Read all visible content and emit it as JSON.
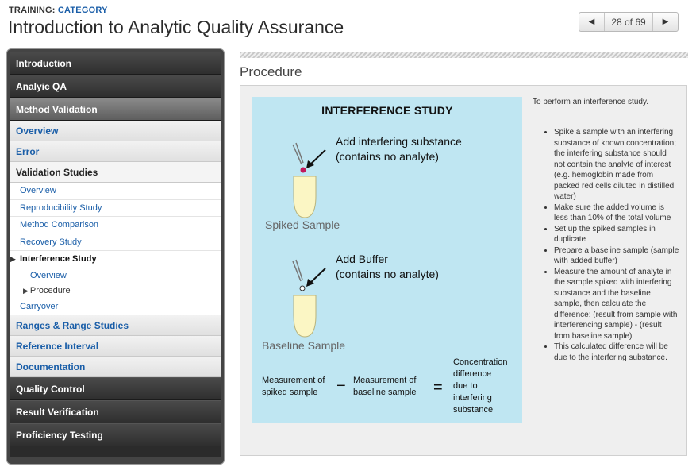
{
  "header": {
    "breadcrumb_prefix": "TRAINING:",
    "breadcrumb_link": "CATEGORY",
    "title": "Introduction to Analytic Quality Assurance"
  },
  "pager": {
    "prev_icon": "left-triangle",
    "next_icon": "right-triangle",
    "count": "28 of 69"
  },
  "sidebar": {
    "top_items": [
      "Introduction",
      "Analyic QA"
    ],
    "active_item": "Method Validation",
    "sections": {
      "overview": "Overview",
      "error": "Error",
      "validation_studies": "Validation Studies"
    },
    "sub_items": {
      "overview": "Overview",
      "reproducibility": "Reproducibility Study",
      "method_comparison": "Method Comparison",
      "recovery": "Recovery Study",
      "interference": "Interference Study",
      "interference_overview": "Overview",
      "procedure": "Procedure",
      "carryover": "Carryover"
    },
    "more_sections": {
      "ranges": "Ranges & Range Studies",
      "reference": "Reference Interval",
      "documentation": "Documentation"
    },
    "bottom_items": [
      "Quality Control",
      "Result Verification",
      "Proficiency Testing"
    ]
  },
  "main": {
    "section_title": "Procedure",
    "figure": {
      "title": "INTERFERENCE STUDY",
      "step1_line1": "Add interfering substance",
      "step1_line2": "(contains no analyte)",
      "spiked_caption": "Spiked Sample",
      "step2_line1": "Add Buffer",
      "step2_line2": "(contains no analyte)",
      "baseline_caption": "Baseline Sample",
      "eq_left_1": "Measurement of",
      "eq_left_2": "spiked sample",
      "eq_minus": "−",
      "eq_mid_1": "Measurement of",
      "eq_mid_2": "baseline sample",
      "eq_equals": "=",
      "eq_right_1": "Concentration",
      "eq_right_2": "difference",
      "eq_right_3": "due to",
      "eq_right_4": "interfering",
      "eq_right_5": "substance",
      "dot_color_spiked": "#c2185b",
      "background_color": "#bfe6f2"
    },
    "intro": "To perform an interference study.",
    "bullets": [
      "Spike a sample with an interfering substance of known concentration; the interfering substance should not contain the analyte of interest (e.g. hemoglobin made from packed red cells diluted in distilled water)",
      "Make sure the added volume is less than 10% of the total volume",
      "Set up the spiked samples in duplicate",
      "Prepare a baseline sample (sample with added buffer)",
      "Measure the amount of analyte in the sample spiked with interfering substance and the baseline sample, then calculate the difference: (result from sample with interferencing sample) - (result from baseline sample)",
      "This calculated difference will be due to the interfering substance."
    ]
  },
  "colors": {
    "link": "#1a5ea8",
    "sidebar_dark": "#333333",
    "sidebar_active": "#6f6f6f"
  }
}
